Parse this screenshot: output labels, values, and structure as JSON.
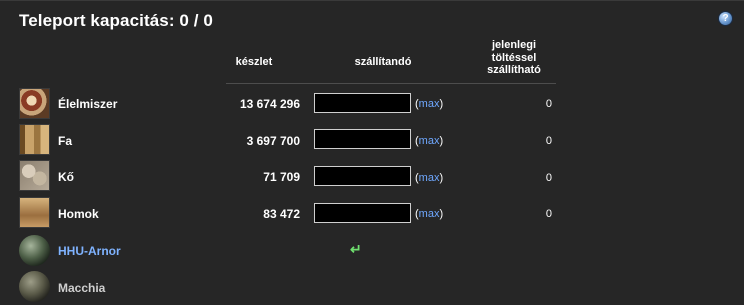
{
  "header": {
    "title": "Teleport kapacitás: 0 / 0",
    "help_glyph": "?"
  },
  "table": {
    "col_stock": "készlet",
    "col_transport": "szállítandó",
    "col_capacity_l1": "jelenlegi",
    "col_capacity_l2": "töltéssel",
    "col_capacity_l3": "szállítható",
    "max_text": "max",
    "resources": [
      {
        "icon": "food-icon",
        "name": "Élelmiszer",
        "stock": "13 674 296",
        "input_value": "",
        "capacity": "0"
      },
      {
        "icon": "wood-icon",
        "name": "Fa",
        "stock": "3 697 700",
        "input_value": "",
        "capacity": "0"
      },
      {
        "icon": "stone-icon",
        "name": "Kő",
        "stock": "71 709",
        "input_value": "",
        "capacity": "0"
      },
      {
        "icon": "sand-icon",
        "name": "Homok",
        "stock": "83 472",
        "input_value": "",
        "capacity": "0"
      }
    ]
  },
  "destinations": [
    {
      "icon": "planet-icon",
      "name": "HHU-Arnor",
      "selected_arrow": "↵"
    },
    {
      "icon": "planet-icon",
      "name": "Macchia"
    }
  ]
}
